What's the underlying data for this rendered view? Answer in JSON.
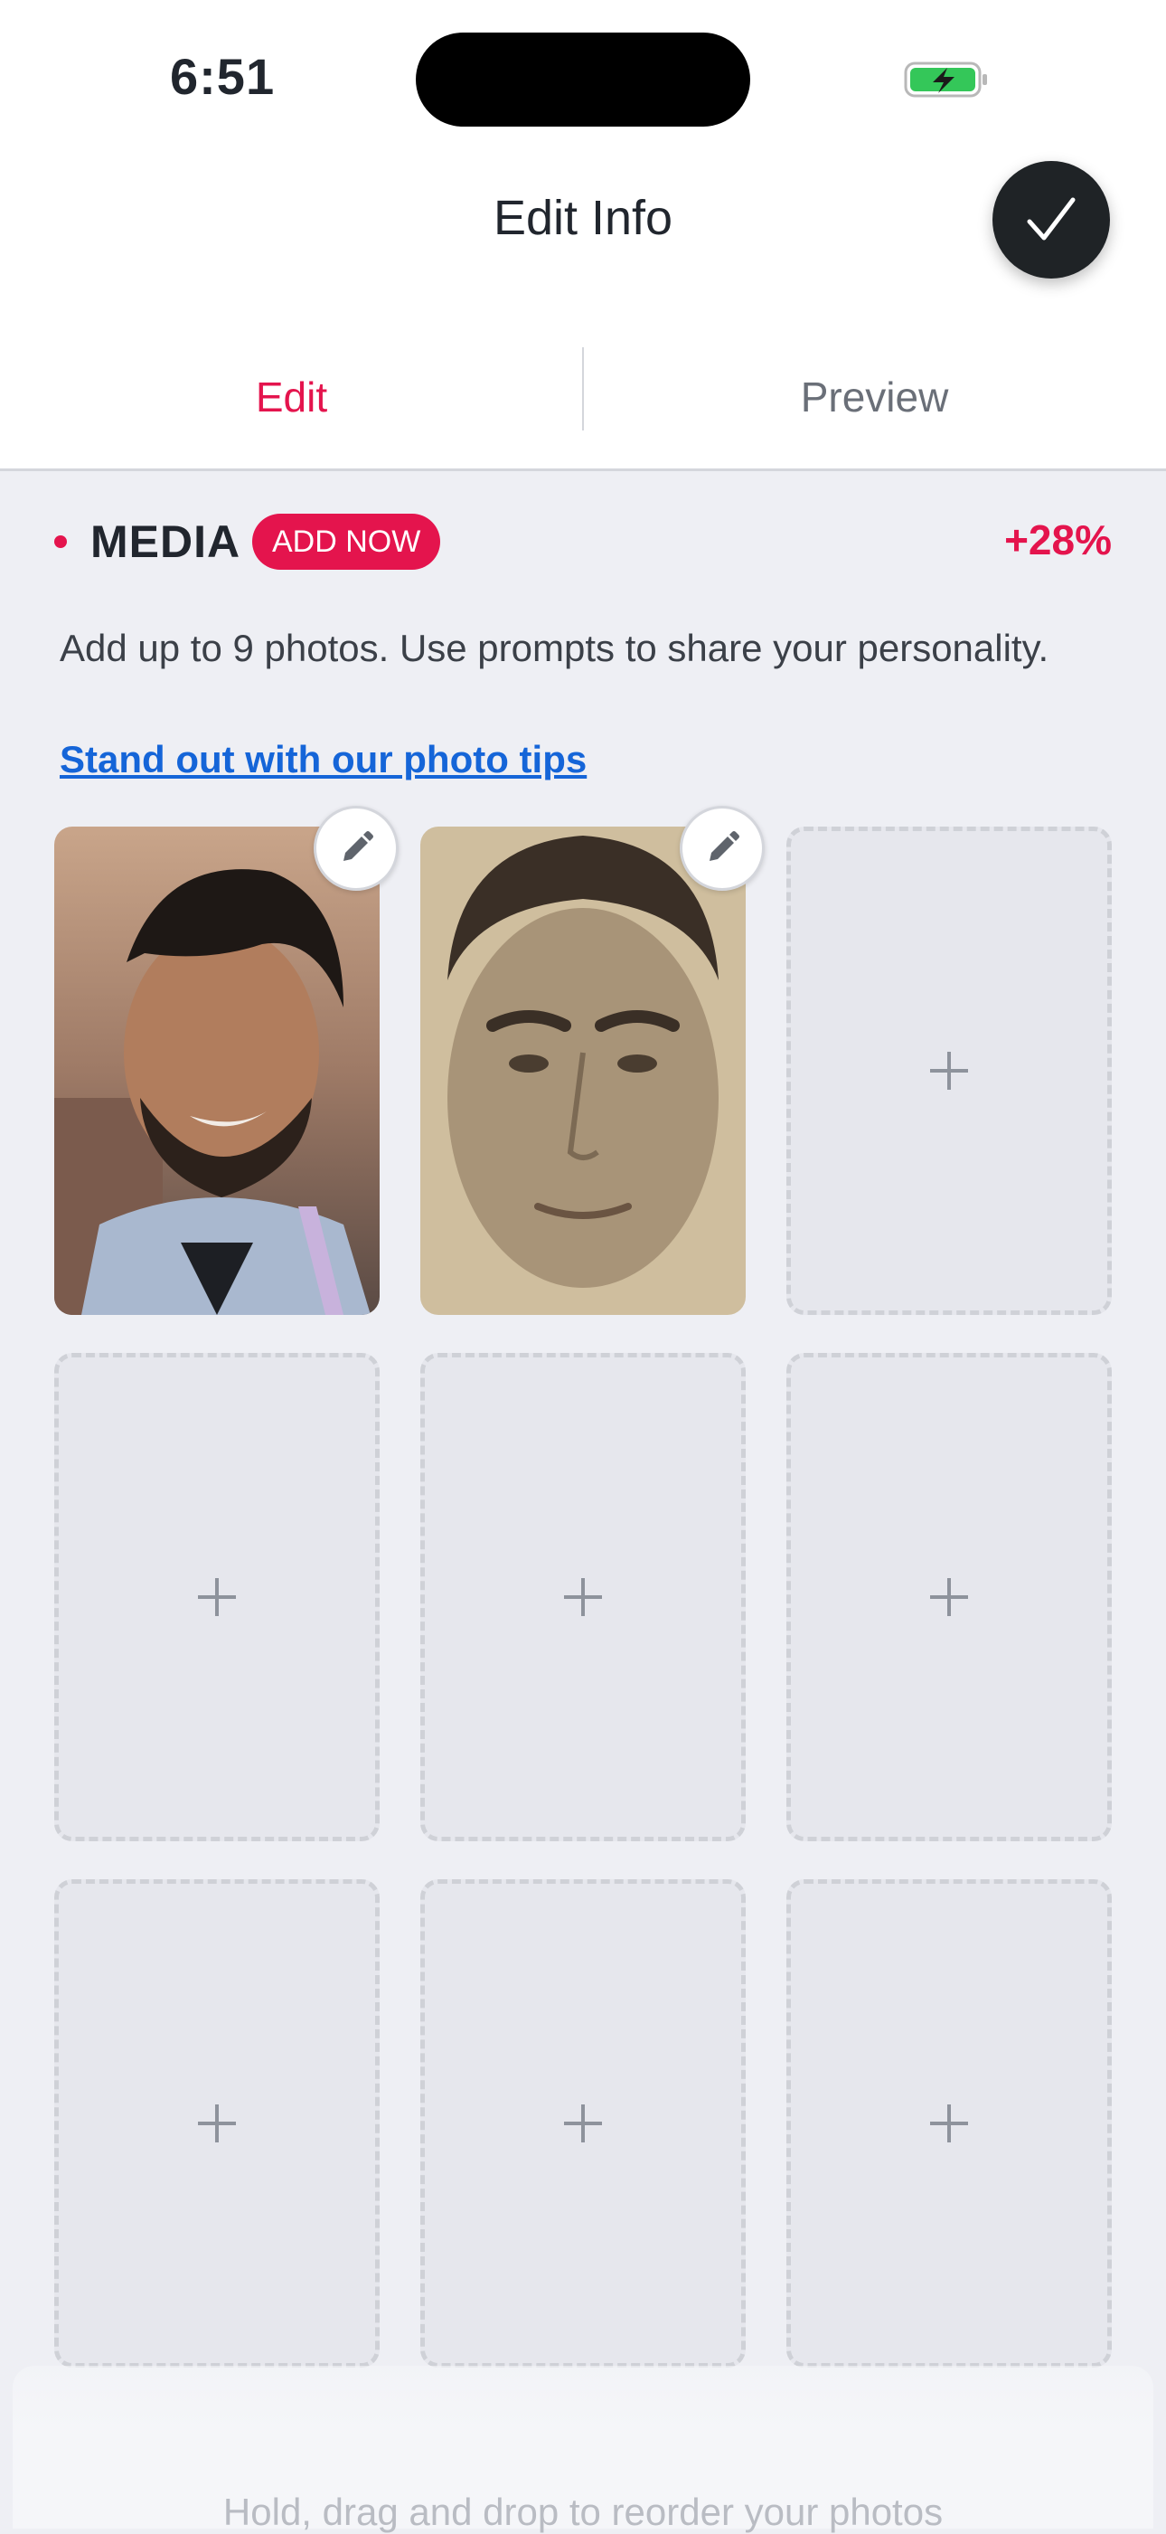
{
  "status_bar": {
    "time": "6:51"
  },
  "header": {
    "title": "Edit Info"
  },
  "tabs": [
    {
      "label": "Edit",
      "active": true
    },
    {
      "label": "Preview",
      "active": false
    }
  ],
  "media": {
    "section_title": "MEDIA",
    "badge_label": "ADD NOW",
    "percent_boost": "+28%",
    "description": "Add up to 9 photos. Use prompts to share your personality.",
    "tips_link": "Stand out with our photo tips",
    "slots": [
      {
        "type": "photo",
        "content": "photo-1"
      },
      {
        "type": "photo",
        "content": "photo-2"
      },
      {
        "type": "empty",
        "content": "add-photo"
      },
      {
        "type": "empty",
        "content": "add-photo"
      },
      {
        "type": "empty",
        "content": "add-photo"
      },
      {
        "type": "empty",
        "content": "add-photo"
      },
      {
        "type": "empty",
        "content": "add-photo"
      },
      {
        "type": "empty",
        "content": "add-photo"
      },
      {
        "type": "empty",
        "content": "add-photo"
      }
    ]
  },
  "footer": {
    "hint": "Hold, drag and drop to reorder your photos"
  },
  "colors": {
    "accent": "#e4144d",
    "link": "#1565d8",
    "battery": "#34c759"
  }
}
